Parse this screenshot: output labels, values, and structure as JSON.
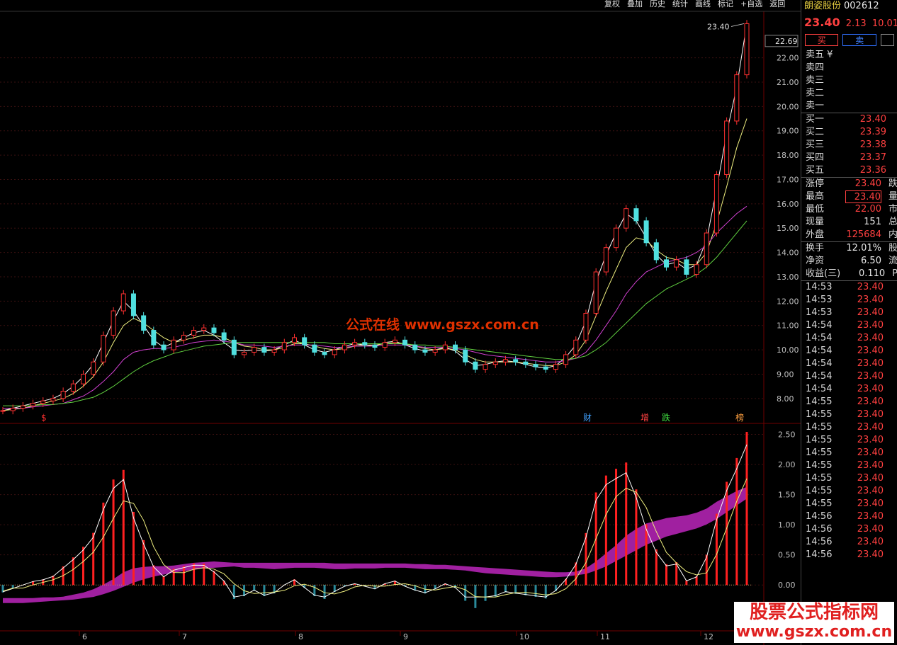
{
  "toolbar": [
    "复权",
    "叠加",
    "历史",
    "统计",
    "画线",
    "标记",
    "+自选",
    "返回"
  ],
  "stock": {
    "name": "朗姿股份",
    "code": "002612",
    "price": "23.40",
    "change": "2.13",
    "pct": "10.01%"
  },
  "buttons": {
    "buy": "买",
    "sell": "卖"
  },
  "orderbook": {
    "sell": [
      {
        "label": "卖五 ¥",
        "price": ""
      },
      {
        "label": "卖四",
        "price": ""
      },
      {
        "label": "卖三",
        "price": ""
      },
      {
        "label": "卖二",
        "price": ""
      },
      {
        "label": "卖一",
        "price": ""
      }
    ],
    "buy": [
      {
        "label": "买一",
        "price": "23.40"
      },
      {
        "label": "买二",
        "price": "23.39"
      },
      {
        "label": "买三",
        "price": "23.38"
      },
      {
        "label": "买四",
        "price": "23.37"
      },
      {
        "label": "买五",
        "price": "23.36"
      }
    ]
  },
  "stats": [
    {
      "label": "涨停",
      "value": "23.40",
      "extra": "跌"
    },
    {
      "label": "最高",
      "value": "23.40",
      "extra": "量"
    },
    {
      "label": "最低",
      "value": "22.00",
      "extra": "市"
    },
    {
      "label": "现量",
      "value": "151",
      "extra": "总"
    },
    {
      "label": "外盘",
      "value": "125684",
      "extra": "内"
    },
    {
      "label": "换手",
      "value": "12.01%",
      "extra": "股"
    },
    {
      "label": "净资",
      "value": "6.50",
      "extra": "流"
    },
    {
      "label": "收益(三)",
      "value": "0.110",
      "extra": "P"
    }
  ],
  "ticks": [
    {
      "time": "14:53",
      "price": "23.40"
    },
    {
      "time": "14:53",
      "price": "23.40"
    },
    {
      "time": "14:53",
      "price": "23.40"
    },
    {
      "time": "14:54",
      "price": "23.40"
    },
    {
      "time": "14:54",
      "price": "23.40"
    },
    {
      "time": "14:54",
      "price": "23.40"
    },
    {
      "time": "14:54",
      "price": "23.40"
    },
    {
      "time": "14:54",
      "price": "23.40"
    },
    {
      "time": "14:54",
      "price": "23.40"
    },
    {
      "time": "14:55",
      "price": "23.40"
    },
    {
      "time": "14:55",
      "price": "23.40"
    },
    {
      "time": "14:55",
      "price": "23.40"
    },
    {
      "time": "14:55",
      "price": "23.40"
    },
    {
      "time": "14:55",
      "price": "23.40"
    },
    {
      "time": "14:55",
      "price": "23.40"
    },
    {
      "time": "14:55",
      "price": "23.40"
    },
    {
      "time": "14:55",
      "price": "23.40"
    },
    {
      "time": "14:55",
      "price": "23.40"
    },
    {
      "time": "14:56",
      "price": "23.40"
    },
    {
      "time": "14:56",
      "price": "23.40"
    },
    {
      "time": "14:56",
      "price": "23.40"
    },
    {
      "time": "14:56",
      "price": "23.40"
    }
  ],
  "chart_data": {
    "type": "line",
    "price_axis": {
      "ticks": [
        "22.00",
        "21.00",
        "20.00",
        "19.00",
        "18.00",
        "17.00",
        "16.00",
        "15.00",
        "14.00",
        "13.00",
        "12.00",
        "11.00",
        "10.00",
        "9.00",
        "8.00"
      ],
      "ylim": [
        7.5,
        23.5
      ]
    },
    "last_price_label": "22.69",
    "high_marker": "23.40",
    "indicator_axis": {
      "ticks": [
        "2.50",
        "2.00",
        "1.50",
        "1.00",
        "0.50",
        "0.00"
      ],
      "ylim": [
        -0.75,
        2.6
      ]
    },
    "x_ticks": [
      "6",
      "7",
      "8",
      "9",
      "10",
      "11",
      "12"
    ],
    "event_markers": [
      "$",
      "财",
      "增",
      "跌",
      "榜"
    ],
    "closes": [
      7.5,
      7.6,
      7.7,
      7.8,
      7.9,
      8.0,
      8.3,
      8.6,
      9.0,
      9.5,
      10.6,
      11.6,
      12.3,
      11.4,
      10.8,
      10.2,
      10.0,
      10.4,
      10.6,
      10.8,
      10.9,
      10.7,
      10.4,
      9.8,
      9.9,
      10.1,
      9.9,
      10.0,
      10.3,
      10.5,
      10.2,
      9.9,
      9.8,
      10.0,
      10.2,
      10.3,
      10.2,
      10.1,
      10.3,
      10.4,
      10.2,
      10.0,
      9.9,
      10.0,
      10.2,
      10.0,
      9.5,
      9.2,
      9.4,
      9.5,
      9.6,
      9.5,
      9.4,
      9.3,
      9.2,
      9.4,
      9.8,
      10.4,
      11.5,
      13.2,
      14.2,
      15.0,
      15.8,
      15.3,
      14.4,
      13.7,
      13.4,
      13.7,
      13.1,
      13.5,
      14.8,
      17.2,
      19.4,
      21.3,
      23.4
    ],
    "ma_series": [
      {
        "color": "#ffffff",
        "values": [
          7.5,
          7.6,
          7.7,
          7.8,
          7.9,
          8.0,
          8.2,
          8.5,
          8.9,
          9.4,
          10.3,
          11.2,
          12.0,
          11.6,
          11.0,
          10.4,
          10.1,
          10.3,
          10.5,
          10.7,
          10.8,
          10.6,
          10.3,
          10.0,
          9.95,
          10.0,
          9.95,
          10.0,
          10.2,
          10.4,
          10.2,
          10.0,
          9.9,
          10.0,
          10.15,
          10.25,
          10.2,
          10.15,
          10.3,
          10.35,
          10.2,
          10.05,
          9.95,
          10.0,
          10.1,
          9.95,
          9.6,
          9.35,
          9.4,
          9.5,
          9.55,
          9.5,
          9.4,
          9.3,
          9.25,
          9.35,
          9.7,
          10.2,
          11.2,
          12.8,
          13.9,
          14.8,
          15.6,
          15.3,
          14.6,
          13.9,
          13.5,
          13.6,
          13.3,
          13.5,
          14.5,
          16.6,
          18.9,
          20.8,
          23.4
        ]
      },
      {
        "color": "#f0f080",
        "values": [
          7.5,
          7.55,
          7.6,
          7.7,
          7.8,
          7.9,
          8.0,
          8.2,
          8.5,
          8.9,
          9.5,
          10.3,
          11.0,
          11.3,
          11.1,
          10.8,
          10.5,
          10.3,
          10.4,
          10.5,
          10.6,
          10.6,
          10.5,
          10.3,
          10.15,
          10.1,
          10.0,
          10.0,
          10.1,
          10.25,
          10.25,
          10.15,
          10.05,
          10.0,
          10.05,
          10.15,
          10.2,
          10.2,
          10.25,
          10.3,
          10.25,
          10.15,
          10.05,
          10.0,
          10.05,
          10.0,
          9.8,
          9.6,
          9.5,
          9.5,
          9.5,
          9.5,
          9.45,
          9.4,
          9.35,
          9.35,
          9.5,
          9.8,
          10.4,
          11.4,
          12.4,
          13.3,
          14.2,
          14.6,
          14.5,
          14.1,
          13.8,
          13.7,
          13.5,
          13.5,
          14.0,
          15.2,
          16.7,
          18.3,
          19.5
        ]
      },
      {
        "color": "#d040d0",
        "values": [
          7.6,
          7.6,
          7.6,
          7.65,
          7.7,
          7.75,
          7.8,
          7.95,
          8.1,
          8.35,
          8.7,
          9.1,
          9.6,
          9.9,
          10.0,
          10.05,
          10.05,
          10.1,
          10.2,
          10.3,
          10.35,
          10.4,
          10.35,
          10.3,
          10.2,
          10.2,
          10.15,
          10.1,
          10.15,
          10.2,
          10.2,
          10.2,
          10.15,
          10.1,
          10.1,
          10.15,
          10.15,
          10.15,
          10.2,
          10.2,
          10.2,
          10.15,
          10.1,
          10.1,
          10.1,
          10.05,
          10.0,
          9.9,
          9.8,
          9.75,
          9.7,
          9.65,
          9.6,
          9.55,
          9.5,
          9.5,
          9.55,
          9.65,
          9.9,
          10.4,
          11.0,
          11.6,
          12.3,
          12.8,
          13.2,
          13.4,
          13.6,
          13.7,
          13.8,
          14.0,
          14.3,
          14.8,
          15.2,
          15.6,
          15.9
        ]
      },
      {
        "color": "#60d040",
        "values": [
          7.7,
          7.7,
          7.7,
          7.7,
          7.75,
          7.75,
          7.8,
          7.85,
          7.95,
          8.05,
          8.25,
          8.5,
          8.8,
          9.1,
          9.35,
          9.55,
          9.7,
          9.85,
          9.95,
          10.05,
          10.15,
          10.2,
          10.25,
          10.3,
          10.3,
          10.3,
          10.3,
          10.3,
          10.3,
          10.3,
          10.3,
          10.3,
          10.3,
          10.25,
          10.25,
          10.25,
          10.25,
          10.25,
          10.25,
          10.25,
          10.25,
          10.2,
          10.2,
          10.15,
          10.15,
          10.1,
          10.05,
          10.0,
          9.95,
          9.9,
          9.85,
          9.8,
          9.75,
          9.7,
          9.65,
          9.6,
          9.6,
          9.65,
          9.75,
          10.0,
          10.3,
          10.7,
          11.1,
          11.5,
          11.9,
          12.2,
          12.5,
          12.7,
          12.9,
          13.1,
          13.4,
          13.8,
          14.3,
          14.8,
          15.3
        ]
      }
    ]
  }
}
